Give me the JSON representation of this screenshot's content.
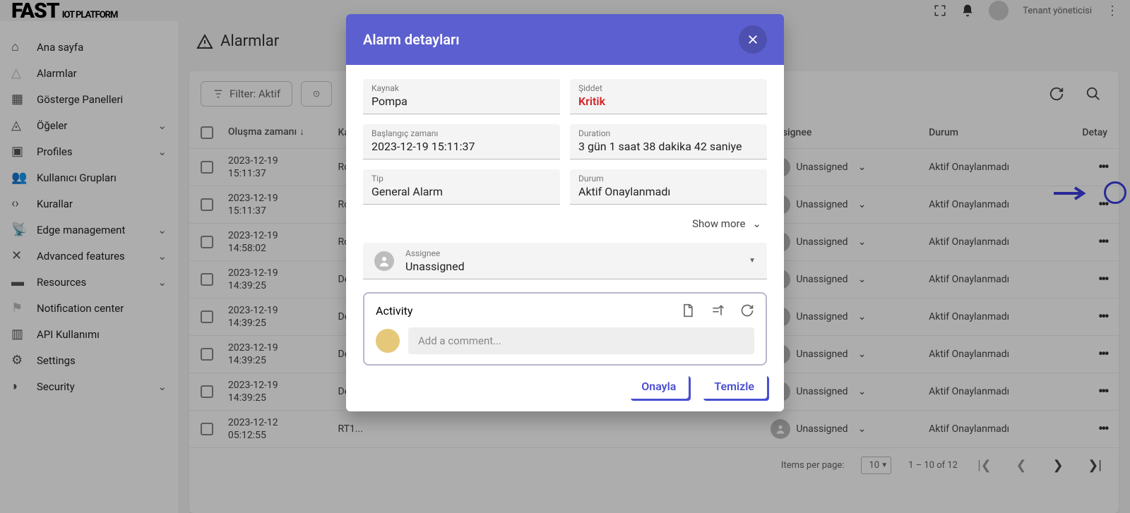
{
  "brand": {
    "bold": "FAST",
    "sub": "IOT PLATFORM"
  },
  "user_role": "Tenant yöneticisi",
  "sidebar": {
    "items": [
      {
        "label": "Ana sayfa",
        "icon": "home",
        "expand": false
      },
      {
        "label": "Alarmlar",
        "icon": "warn",
        "expand": false,
        "faded": true
      },
      {
        "label": "Gösterge Panelleri",
        "icon": "dash",
        "expand": false
      },
      {
        "label": "Öğeler",
        "icon": "entity",
        "expand": true
      },
      {
        "label": "Profiles",
        "icon": "badge",
        "expand": true
      },
      {
        "label": "Kullanıcı Grupları",
        "icon": "users",
        "expand": false
      },
      {
        "label": "Kurallar",
        "icon": "code",
        "expand": false
      },
      {
        "label": "Edge management",
        "icon": "antenna",
        "expand": true
      },
      {
        "label": "Advanced features",
        "icon": "tools",
        "expand": true
      },
      {
        "label": "Resources",
        "icon": "folder",
        "expand": true
      },
      {
        "label": "Notification center",
        "icon": "flag",
        "expand": false,
        "faded": true
      },
      {
        "label": "API Kullanımı",
        "icon": "chart",
        "expand": false
      },
      {
        "label": "Settings",
        "icon": "gear",
        "expand": false
      },
      {
        "label": "Security",
        "icon": "shield",
        "expand": true
      }
    ]
  },
  "page": {
    "title": "Alarmlar"
  },
  "toolbar": {
    "filter_label": "Filter: Aktif"
  },
  "columns": {
    "check": "",
    "time": "Oluşma zamanı",
    "orig": "Kaynak",
    "type": "",
    "sev": "",
    "assign": "Assignee",
    "status": "Durum",
    "actions": "Detay"
  },
  "hidden_originator_prefix": "Rolt",
  "hidden_originator_prefix2": "Dele",
  "rows": [
    {
      "t1": "2023-12-19",
      "t2": "15:11:37",
      "orig": "Rolt",
      "assign": "Unassigned",
      "status": "Aktif Onaylanmadı"
    },
    {
      "t1": "2023-12-19",
      "t2": "15:11:37",
      "orig": "Rolt",
      "assign": "Unassigned",
      "status": "Aktif Onaylanmadı"
    },
    {
      "t1": "2023-12-19",
      "t2": "14:58:02",
      "orig": "Rolt",
      "assign": "Unassigned",
      "status": "Aktif Onaylanmadı"
    },
    {
      "t1": "2023-12-19",
      "t2": "14:39:25",
      "orig": "Dele",
      "assign": "Unassigned",
      "status": "Aktif Onaylanmadı"
    },
    {
      "t1": "2023-12-19",
      "t2": "14:39:25",
      "orig": "Dele",
      "assign": "Unassigned",
      "status": "Aktif Onaylanmadı"
    },
    {
      "t1": "2023-12-19",
      "t2": "14:39:25",
      "orig": "Dele",
      "assign": "Unassigned",
      "status": "Aktif Onaylanmadı"
    },
    {
      "t1": "2023-12-19",
      "t2": "14:39:25",
      "orig": "Dele",
      "assign": "Unassigned",
      "status": "Aktif Onaylanmadı"
    },
    {
      "t1": "2023-12-12",
      "t2": "05:12:55",
      "orig": "RT1...",
      "assign": "Unassigned",
      "status": "Aktif Onaylanmadı"
    }
  ],
  "pagination": {
    "label": "Items per page:",
    "size": "10",
    "range": "1 – 10 of 12"
  },
  "modal": {
    "title": "Alarm detayları",
    "fields": {
      "originator_label": "Kaynak",
      "originator_value": "Pompa",
      "severity_label": "Şiddet",
      "severity_value": "Kritik",
      "start_label": "Başlangıç zamanı",
      "start_value": "2023-12-19 15:11:37",
      "duration_label": "Duration",
      "duration_value": "3 gün 1 saat 38 dakika 42 saniye",
      "type_label": "Tip",
      "type_value": "General Alarm",
      "status_label": "Durum",
      "status_value": "Aktif Onaylanmadı"
    },
    "show_more": "Show more",
    "assignee_label": "Assignee",
    "assignee_value": "Unassigned",
    "activity_title": "Activity",
    "comment_placeholder": "Add a comment...",
    "ack_btn": "Onayla",
    "clear_btn": "Temizle"
  }
}
